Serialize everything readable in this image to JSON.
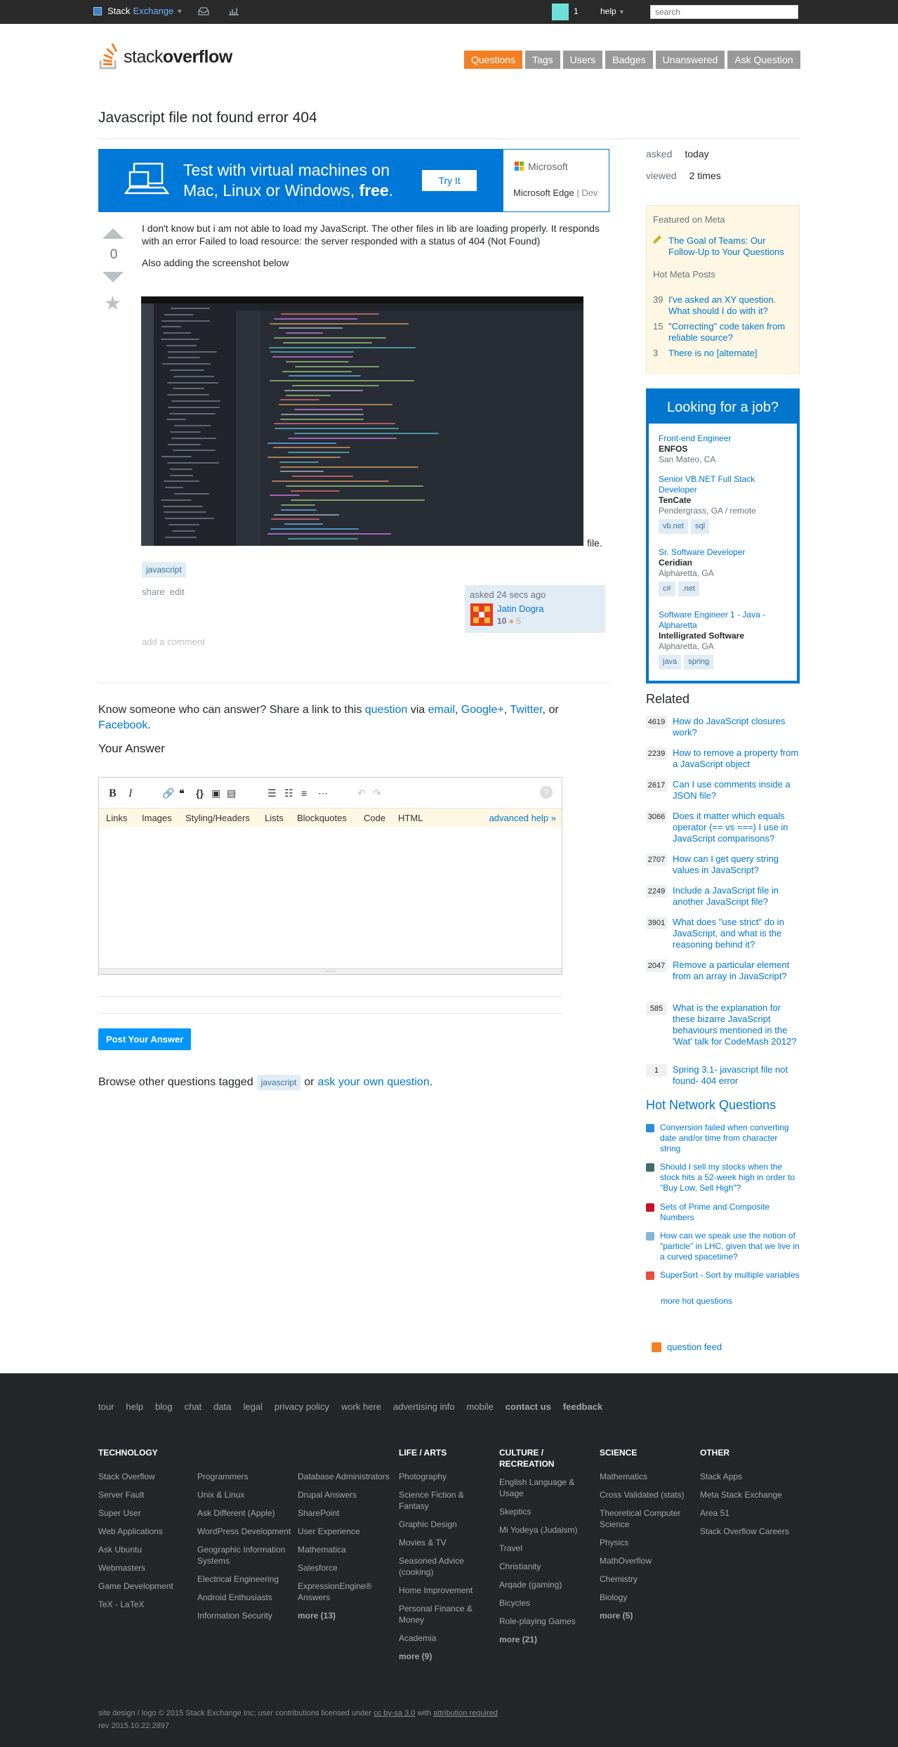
{
  "topbar": {
    "brand_left": "Stack",
    "brand_right": "Exchange",
    "reputation": "1",
    "help_label": "help",
    "search_placeholder": "search"
  },
  "header": {
    "logo_text_light": "stack",
    "logo_text_bold": "overflow",
    "nav": [
      "Questions",
      "Tags",
      "Users",
      "Badges",
      "Unanswered",
      "Ask Question"
    ]
  },
  "question": {
    "title": "Javascript file not found error 404",
    "votes": "0",
    "body_1": "I don't know but i am not able to load my JavaScript. The other files in lib are loading properly. It responds with an error Failed to load resource: the server responded with a status of 404 (Not Found)",
    "body_2": "Also adding the screenshot below",
    "file_suffix": "file.",
    "tag": "javascript",
    "share": "share",
    "edit": "edit",
    "asked": "asked 24 secs ago",
    "user_name": "Jatin Dogra",
    "user_rep": "10",
    "user_badges": "● 5",
    "add_comment": "add a comment"
  },
  "ad": {
    "line1": "Test with virtual machines on",
    "line2": "Mac, Linux or Windows,",
    "line2_bold": "free",
    "cta": "Try It",
    "brand": "Microsoft",
    "product": "Microsoft Edge",
    "product_suffix": "| Dev"
  },
  "stats": {
    "asked_label": "asked",
    "asked_value": "today",
    "viewed_label": "viewed",
    "viewed_value": "2 times"
  },
  "answer_area": {
    "know_pre": "Know someone who can answer? Share a link to this",
    "question_link": "question",
    "via": "via",
    "email": "email",
    "gplus": "Google+",
    "twitter": "Twitter",
    "or": ", or",
    "facebook": "Facebook",
    "your_answer": "Your Answer",
    "help_tabs": [
      "Links",
      "Images",
      "Styling/Headers",
      "Lists",
      "Blockquotes",
      "Code",
      "HTML"
    ],
    "advanced_help": "advanced help »",
    "post_button": "Post Your Answer",
    "browse_pre": "Browse other questions tagged",
    "browse_tag": "javascript",
    "browse_or": "or",
    "browse_link": "ask your own question",
    "browse_end": "."
  },
  "meta": {
    "featured_title": "Featured on Meta",
    "featured_item": "The Goal of Teams: Our Follow-Up to Your Questions",
    "hot_title": "Hot Meta Posts",
    "hot": [
      {
        "n": "39",
        "t": "I've asked an XY question. What should I do with it?"
      },
      {
        "n": "15",
        "t": "\"Correcting\" code taken from reliable source?"
      },
      {
        "n": "3",
        "t": "There is no [alternate]"
      }
    ]
  },
  "jobs": {
    "title": "Looking for a job?",
    "list": [
      {
        "title": "Front-end Engineer",
        "company": "ENFOS",
        "location": "San Mateo, CA",
        "tags": []
      },
      {
        "title": "Senior VB.NET Full Stack Developer",
        "company": "TenCate",
        "location": "Pendergrass, GA / remote",
        "tags": [
          "vb.net",
          "sql"
        ]
      },
      {
        "title": "Sr. Software Developer",
        "company": "Ceridian",
        "location": "Alpharetta, GA",
        "tags": [
          "c#",
          ".net"
        ]
      },
      {
        "title": "Software Engineer 1 - Java - Alpharetta",
        "company": "Intelligrated Software",
        "location": "Alpharetta, GA",
        "tags": [
          "java",
          "spring"
        ]
      }
    ]
  },
  "related": {
    "title": "Related",
    "items": [
      {
        "c": "4619",
        "t": "How do JavaScript closures work?"
      },
      {
        "c": "2239",
        "t": "How to remove a property from a JavaScript object"
      },
      {
        "c": "2617",
        "t": "Can I use comments inside a JSON file?"
      },
      {
        "c": "3066",
        "t": "Does it matter which equals operator (== vs ===) I use in JavaScript comparisons?"
      },
      {
        "c": "2707",
        "t": "How can I get query string values in JavaScript?"
      },
      {
        "c": "2249",
        "t": "Include a JavaScript file in another JavaScript file?"
      },
      {
        "c": "3901",
        "t": "What does \"use strict\" do in JavaScript, and what is the reasoning behind it?"
      },
      {
        "c": "2047",
        "t": "Remove a particular element from an array in JavaScript?"
      },
      {
        "c": "585",
        "t": "What is the explanation for these bizarre JavaScript behaviours mentioned in the 'Wat' talk for CodeMash 2012?"
      },
      {
        "c": "1",
        "t": "Spring 3.1- javascript file not found- 404 error"
      }
    ]
  },
  "hot_network": {
    "title": "Hot Network Questions",
    "items": [
      {
        "t": "Conversion failed when converting date and/or time from character string",
        "color": "#2d8fd5"
      },
      {
        "t": "Should I sell my stocks when the stock hits a 52-week high in order to \"Buy Low, Sell High\"?",
        "color": "#3d6e6c"
      },
      {
        "t": "Sets of Prime and Composite Numbers",
        "color": "#c8102e"
      },
      {
        "t": "How can we speak use the notion of \"particle\" in LHC, given that we live in a curved spacetime?",
        "color": "#7fb8d8"
      },
      {
        "t": "SuperSort - Sort by multiple variables",
        "color": "#e84c3d"
      }
    ],
    "more": "more hot questions",
    "feed": "question feed"
  },
  "footer": {
    "links": [
      "tour",
      "help",
      "blog",
      "chat",
      "data",
      "legal",
      "privacy policy",
      "work here",
      "advertising info",
      "mobile",
      "contact us",
      "feedback"
    ],
    "technology_title": "TECHNOLOGY",
    "tech_col1": [
      "Stack Overflow",
      "Server Fault",
      "Super User",
      "Web Applications",
      "Ask Ubuntu",
      "Webmasters",
      "Game Development",
      "TeX - LaTeX"
    ],
    "tech_col2": [
      "Programmers",
      "Unix & Linux",
      "Ask Different (Apple)",
      "WordPress Development",
      "Geographic Information Systems",
      "Electrical Engineering",
      "Android Enthusiasts",
      "Information Security"
    ],
    "tech_col3": [
      "Database Administrators",
      "Drupal Answers",
      "SharePoint",
      "User Experience",
      "Mathematica",
      "Salesforce",
      "ExpressionEngine® Answers",
      "more (13)"
    ],
    "life_title": "LIFE / ARTS",
    "life": [
      "Photography",
      "Science Fiction & Fantasy",
      "Graphic Design",
      "Movies & TV",
      "Seasoned Advice (cooking)",
      "Home Improvement",
      "Personal Finance & Money",
      "Academia",
      "more (9)"
    ],
    "culture_title": "CULTURE / RECREATION",
    "culture": [
      "English Language & Usage",
      "Skeptics",
      "Mi Yodeya (Judaism)",
      "Travel",
      "Christianity",
      "Arqade (gaming)",
      "Bicycles",
      "Role-playing Games",
      "more (21)"
    ],
    "science_title": "SCIENCE",
    "science": [
      "Mathematics",
      "Cross Validated (stats)",
      "Theoretical Computer Science",
      "Physics",
      "MathOverflow",
      "Chemistry",
      "Biology",
      "more (5)"
    ],
    "other_title": "OTHER",
    "other": [
      "Stack Apps",
      "Meta Stack Exchange",
      "Area 51",
      "Stack Overflow Careers"
    ],
    "copy_pre": "site design / logo © 2015 Stack Exchange Inc; user contributions licensed under",
    "copy_lic": "cc by-sa 3.0",
    "copy_with": "with",
    "copy_attr": "attribution required",
    "rev": "rev 2015.10.22.2897"
  },
  "colors": {
    "accent": "#f48024",
    "link": "#0077cc",
    "footer_bg": "#242729"
  }
}
